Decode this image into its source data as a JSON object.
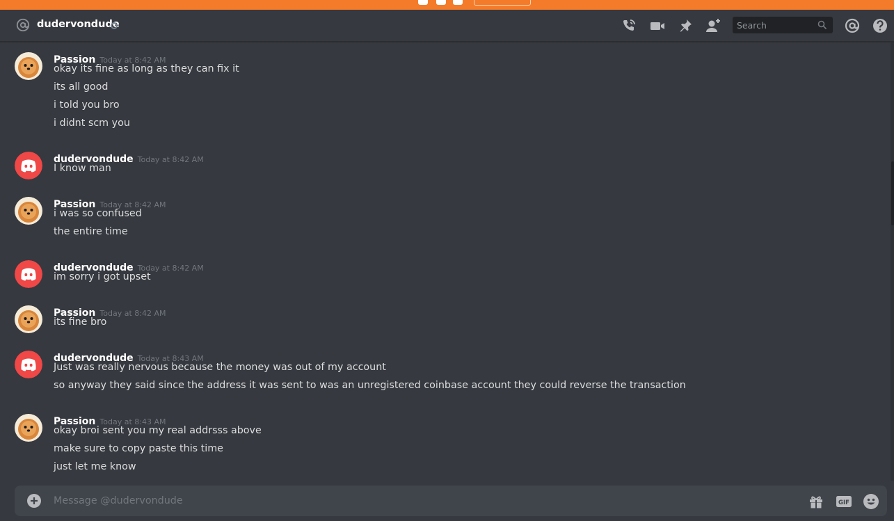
{
  "header": {
    "channel_name": "dudervondude",
    "search_placeholder": "Search"
  },
  "groups": [
    {
      "author": "Passion",
      "avatar": "dog-avatar",
      "timestamp": "Today at 8:42 AM",
      "lines": [
        "okay its fine as long as they can fix it",
        "its all good",
        "i told you bro",
        "i didnt scm you"
      ]
    },
    {
      "author": "dudervondude",
      "avatar": "discord-logo-avatar",
      "timestamp": "Today at 8:42 AM",
      "lines": [
        "I know man"
      ]
    },
    {
      "author": "Passion",
      "avatar": "dog-avatar",
      "timestamp": "Today at 8:42 AM",
      "lines": [
        "i was so confused",
        "the entire time"
      ]
    },
    {
      "author": "dudervondude",
      "avatar": "discord-logo-avatar",
      "timestamp": "Today at 8:42 AM",
      "lines": [
        "im sorry i got upset"
      ]
    },
    {
      "author": "Passion",
      "avatar": "dog-avatar",
      "timestamp": "Today at 8:42 AM",
      "lines": [
        "its fine bro"
      ]
    },
    {
      "author": "dudervondude",
      "avatar": "discord-logo-avatar",
      "timestamp": "Today at 8:43 AM",
      "lines": [
        "Just was really nervous because the money was out of my account",
        "so anyway they said since the address it was sent to was an unregistered coinbase account they could reverse the transaction"
      ]
    },
    {
      "author": "Passion",
      "avatar": "dog-avatar",
      "timestamp": "Today at 8:43 AM",
      "lines": [
        "okay broi sent you my real addrsss above",
        "make sure to copy paste this time",
        "just let me know"
      ]
    }
  ],
  "composer": {
    "placeholder": "Message @dudervondude",
    "icons": [
      "add-attachment-icon",
      "gift-icon",
      "gif-icon",
      "emoji-icon"
    ]
  },
  "colors": {
    "banner": "#f47b2a",
    "background": "#36393f",
    "composer": "#40444b",
    "discord_red": "#f04747",
    "username": "#ffffff",
    "timestamp": "#72767d"
  }
}
